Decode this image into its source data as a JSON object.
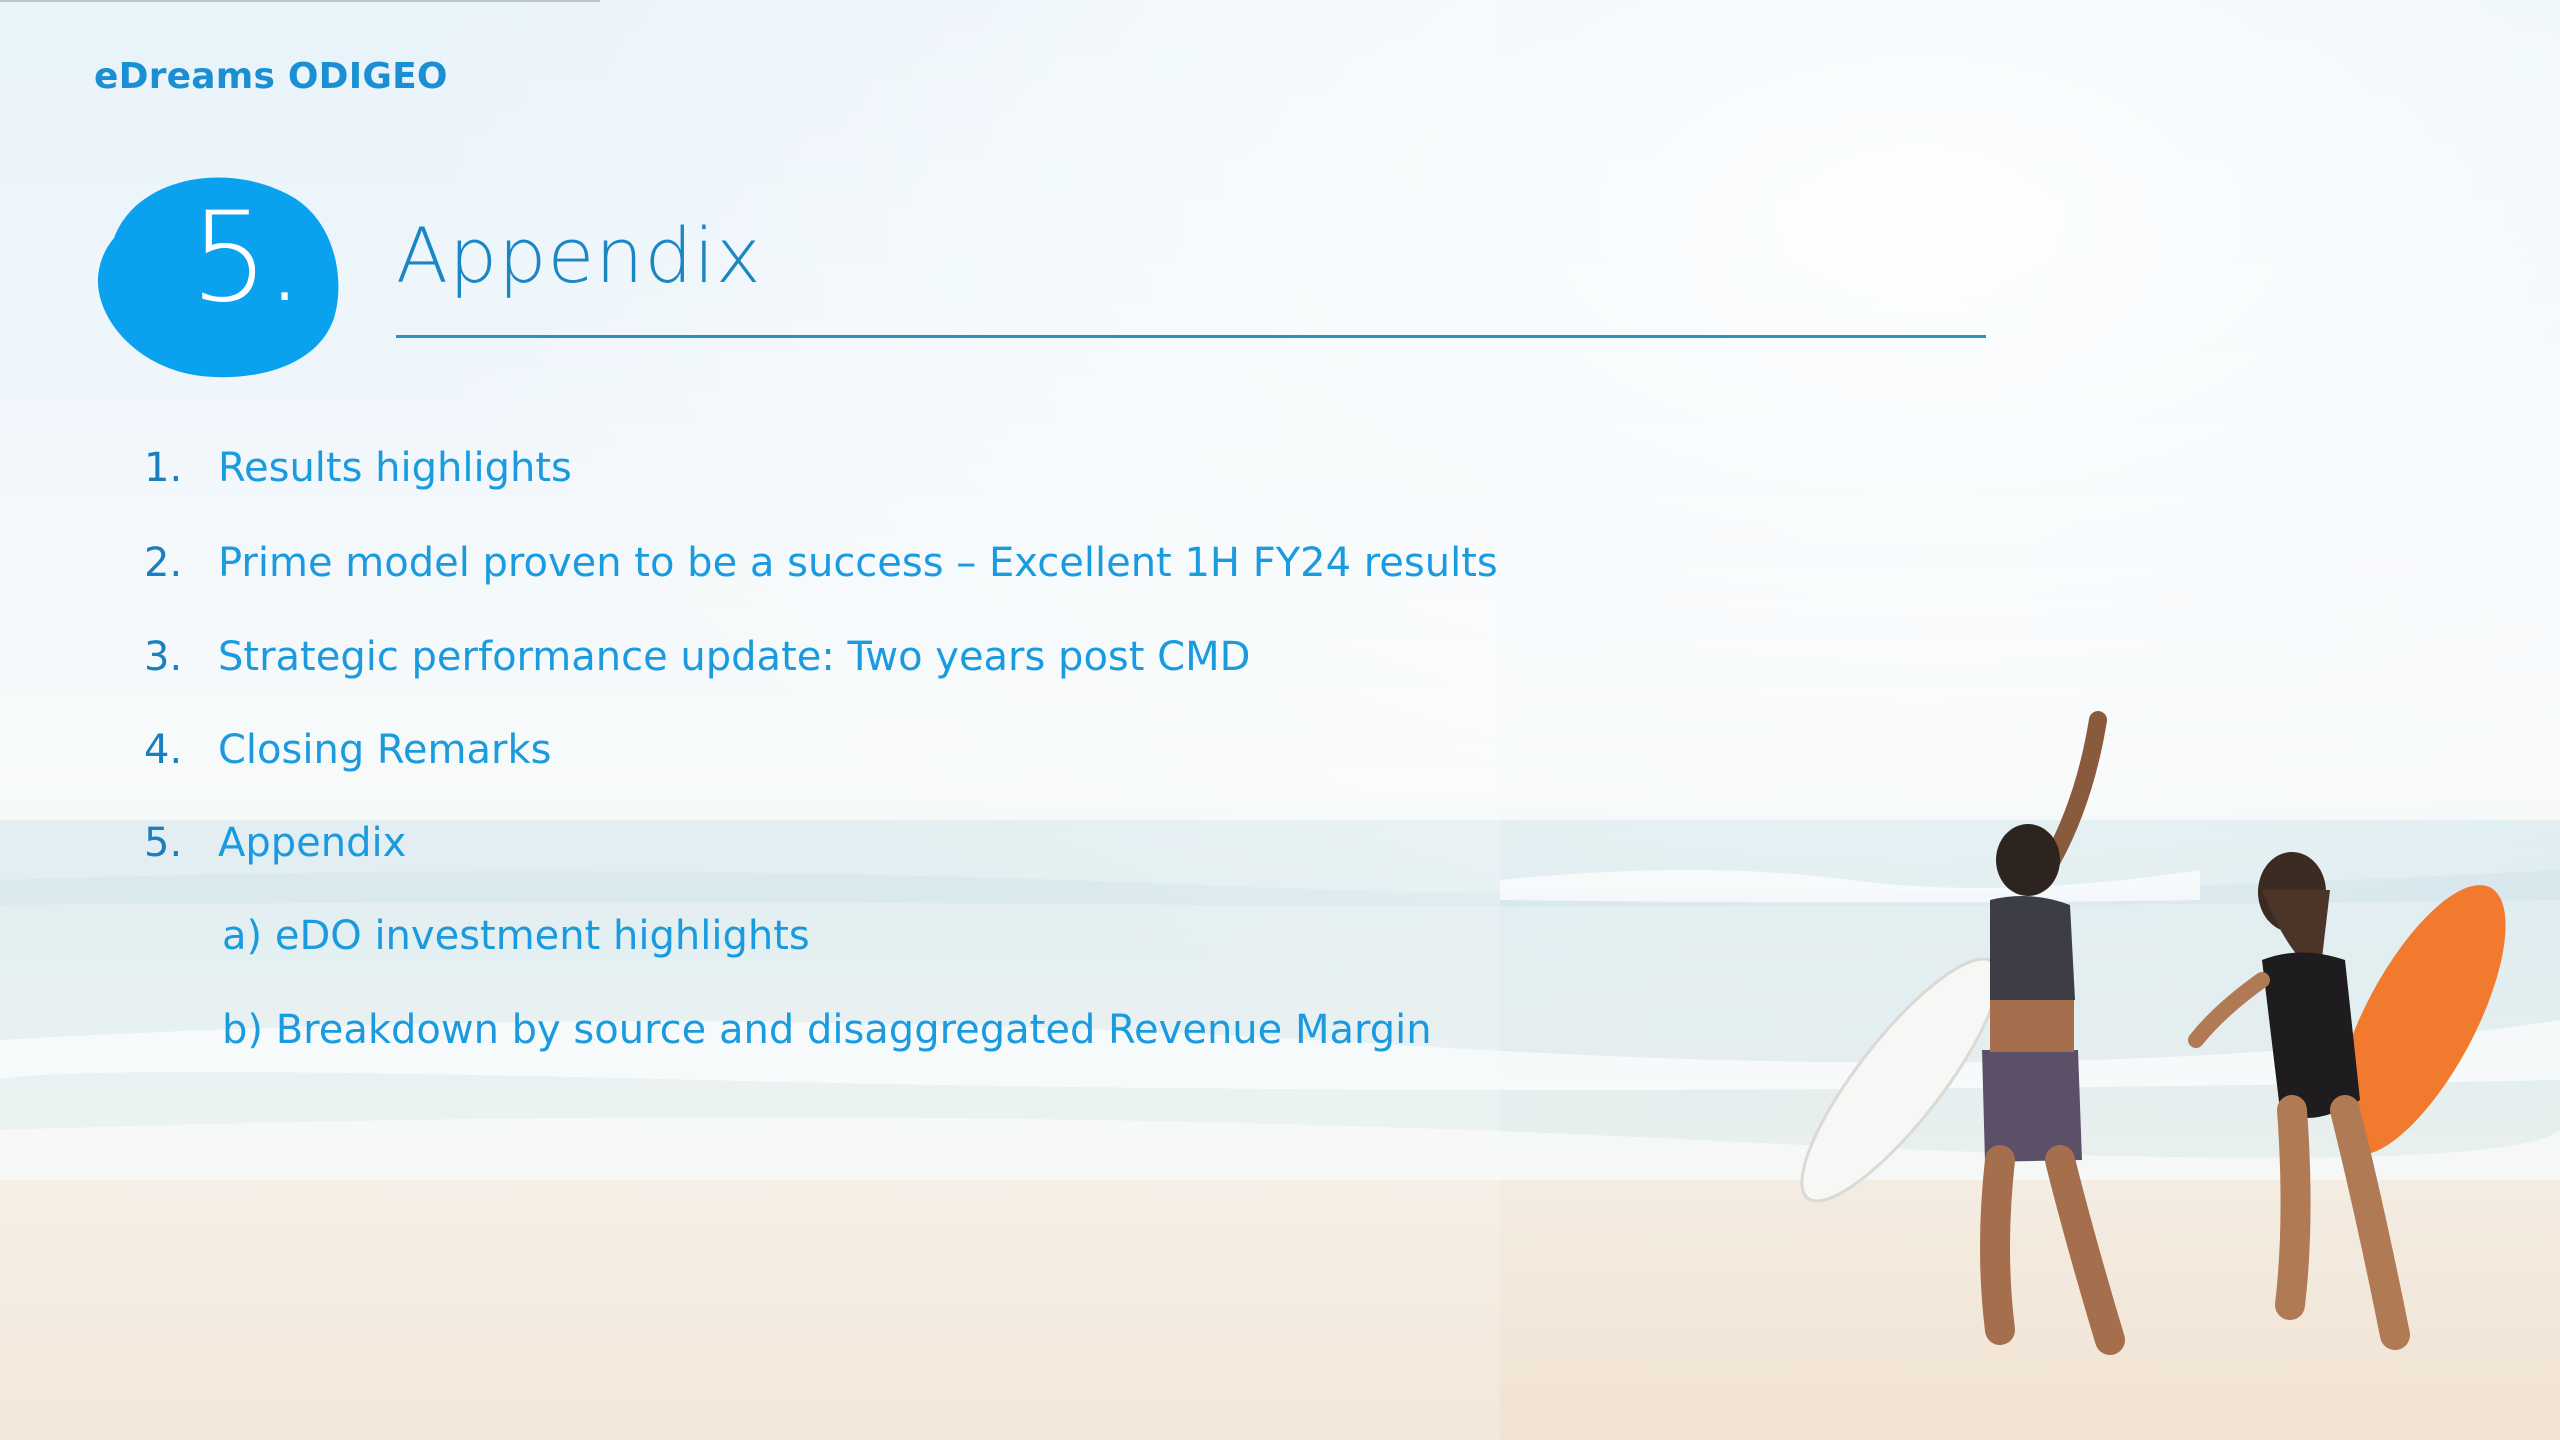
{
  "brand": {
    "name": "eDreams ODIGEO"
  },
  "section": {
    "number": "5.",
    "title": "Appendix"
  },
  "agenda": {
    "items": [
      {
        "num": "1.",
        "label": "Results highlights"
      },
      {
        "num": "2.",
        "label": "Prime model proven to be a success – Excellent 1H FY24 results"
      },
      {
        "num": "3.",
        "label": "Strategic performance update: Two years post CMD"
      },
      {
        "num": "4.",
        "label": "Closing Remarks"
      },
      {
        "num": "5.",
        "label": "Appendix"
      }
    ],
    "subitems": [
      {
        "label": "a) eDO investment highlights"
      },
      {
        "label": "b) Breakdown by source and disaggregated Revenue Margin"
      }
    ]
  },
  "colors": {
    "accent": "#1a9be0",
    "badge": "#0aa2ee",
    "rule": "#2e8fc8"
  },
  "icons": {
    "section_badge": "blob-circle-badge",
    "background_photo": "beach-surfers-photo"
  }
}
